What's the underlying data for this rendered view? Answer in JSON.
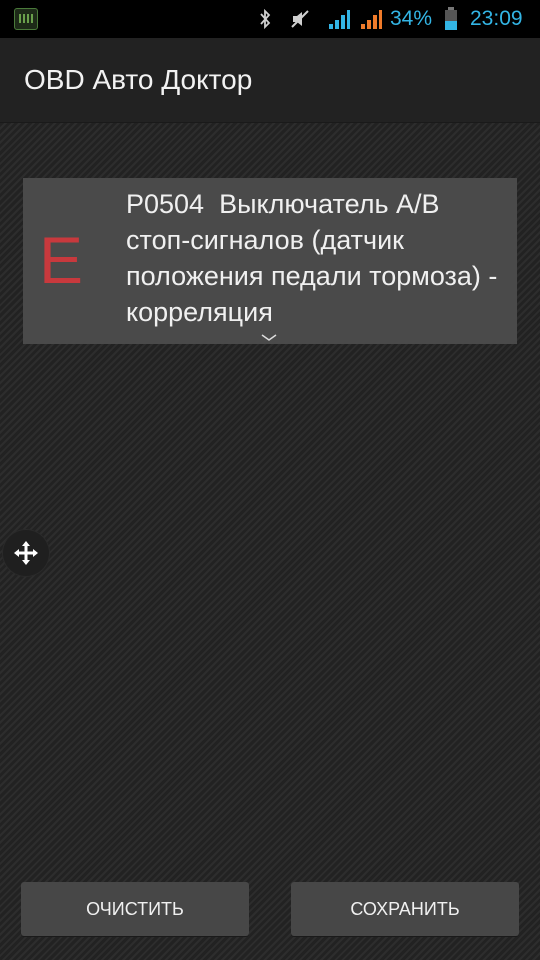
{
  "status_bar": {
    "battery_percent": "34%",
    "time": "23:09",
    "icons": [
      "notification-app-icon",
      "bluetooth-icon",
      "mute-icon",
      "signal-icon",
      "signal-icon",
      "battery-icon"
    ],
    "accent_color": "#33b5e5"
  },
  "action_bar": {
    "title": "OBD Авто Доктор"
  },
  "error_item": {
    "letter": "E",
    "letter_color": "#c8393d",
    "text": "P0504  Выключатель A/B стоп-сигналов (датчик положения педали тормоза) - корреляция"
  },
  "floating": {
    "icon": "move-icon"
  },
  "buttons": {
    "clear_label": "ОЧИСТИТЬ",
    "save_label": "СОХРАНИТЬ"
  }
}
